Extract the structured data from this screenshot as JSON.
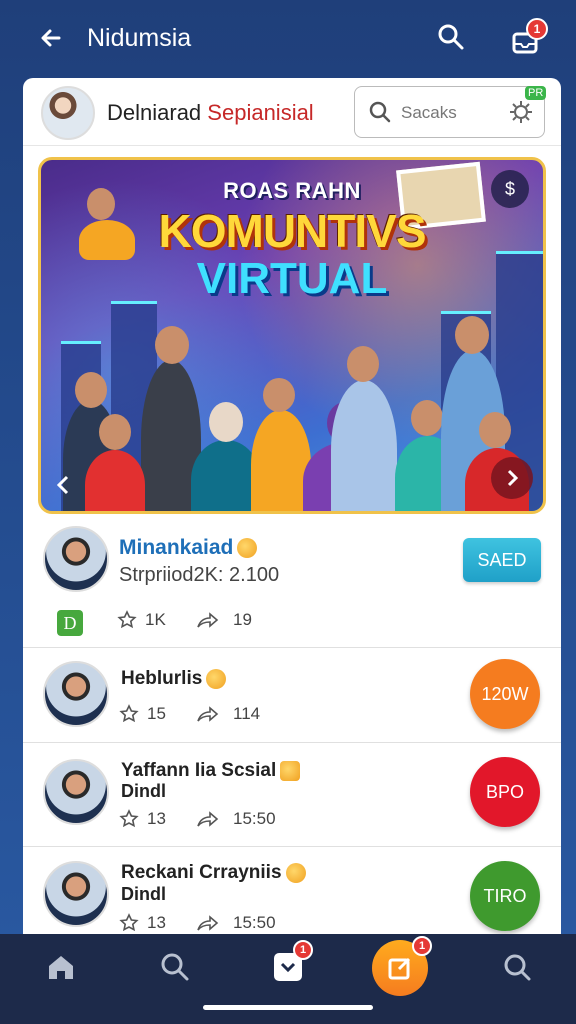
{
  "topbar": {
    "title": "Nidumsia",
    "inbox_badge": "1"
  },
  "header": {
    "name_part1": "Delniarad",
    "name_part2": "Sepianisial",
    "search_placeholder": "Sacaks",
    "mini_badge": "PR"
  },
  "banner": {
    "small_title": "ROAS RAHN",
    "big_title_1": "KOMUNTIVS",
    "big_title_2": "VIRTUAL",
    "corner_btn": "$"
  },
  "feature": {
    "name": "Minankaiad",
    "subtitle": "Strpriiod2K: 2.100",
    "button": "SAED",
    "badge": "D",
    "stars": "1K",
    "shares": "19"
  },
  "rows": [
    {
      "name": "Heblurlis",
      "stars": "15",
      "shares": "114",
      "button": "120W",
      "color": "#f57c1f"
    },
    {
      "name": "Yaffann Iia Scsial",
      "name2": "Dindl",
      "stars": "13",
      "shares": "15:50",
      "button": "BPO",
      "color": "#e2172a"
    },
    {
      "name": "Reckani Crrayniis",
      "name2": "Dindl",
      "stars": "13",
      "shares": "15:50",
      "button": "TIRO",
      "color": "#3f9a2e"
    }
  ],
  "bottom_nav": {
    "inbox_badge": "1",
    "compose_badge": "1"
  }
}
